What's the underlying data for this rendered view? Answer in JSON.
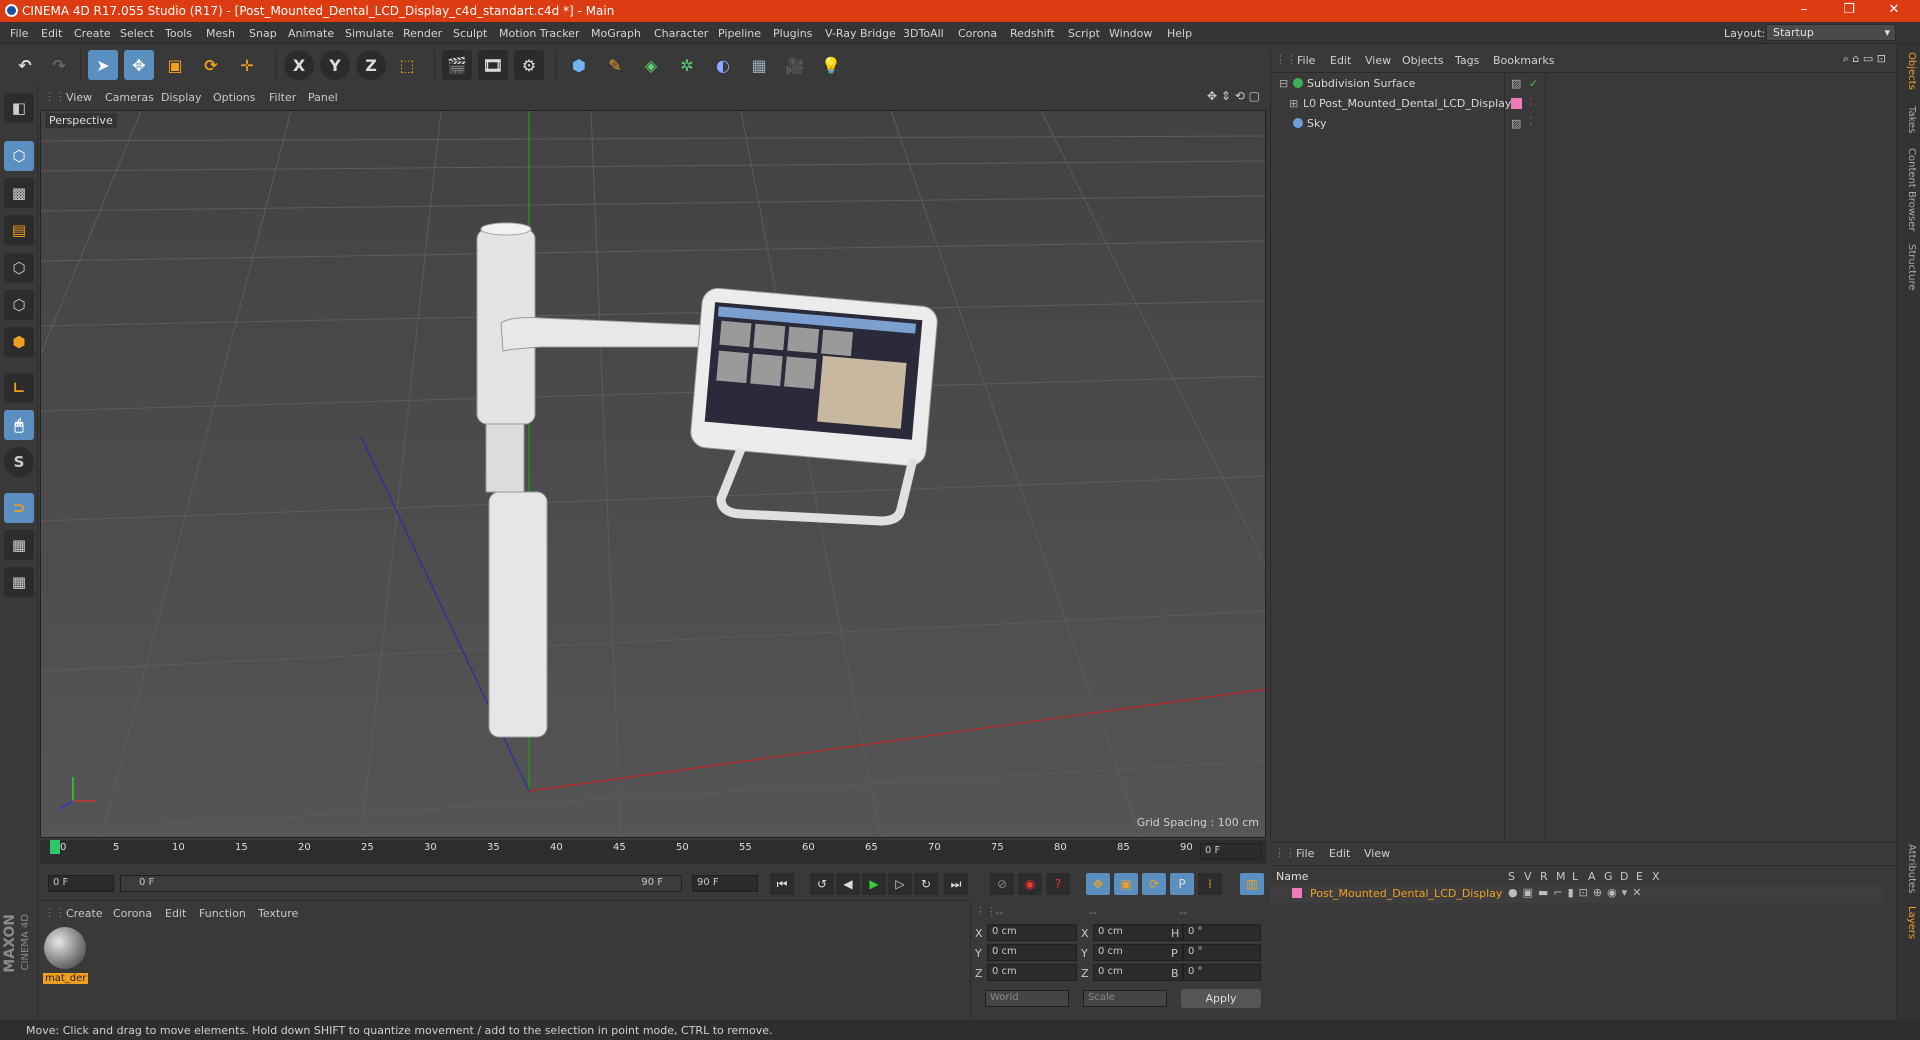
{
  "window": {
    "title": "CINEMA 4D R17.055 Studio (R17) - [Post_Mounted_Dental_LCD_Display_c4d_standart.c4d *] - Main",
    "controls": [
      "–",
      "❐",
      "✕"
    ]
  },
  "menu": [
    "File",
    "Edit",
    "Create",
    "Select",
    "Tools",
    "Mesh",
    "Snap",
    "Animate",
    "Simulate",
    "Render",
    "Sculpt",
    "Motion Tracker",
    "MoGraph",
    "Character",
    "Pipeline",
    "Plugins",
    "V-Ray Bridge",
    "3DToAll",
    "Corona",
    "Redshift",
    "Script",
    "Window",
    "Help"
  ],
  "layout": {
    "label": "Layout:",
    "value": "Startup"
  },
  "toolbar": {
    "axis_x": "X",
    "axis_y": "Y",
    "axis_z": "Z"
  },
  "viewport": {
    "menu": [
      "View",
      "Cameras",
      "Display",
      "Options",
      "Filter",
      "Panel"
    ],
    "camera_label": "Perspective",
    "grid_spacing": "Grid Spacing : 100 cm"
  },
  "timeline": {
    "ticks": [
      "0",
      "5",
      "10",
      "15",
      "20",
      "25",
      "30",
      "35",
      "40",
      "45",
      "50",
      "55",
      "60",
      "65",
      "70",
      "75",
      "80",
      "85",
      "90"
    ],
    "current_frame": "0 F",
    "start_field": "0 F",
    "range_start": "0 F",
    "range_end": "90 F",
    "end_field": "90 F"
  },
  "material_panel": {
    "menu": [
      "Create",
      "Corona",
      "Edit",
      "Function",
      "Texture"
    ],
    "material_name": "mat_der",
    "brand_top": "MAXON",
    "brand_bottom": "CINEMA 4D"
  },
  "coord_panel": {
    "headers": [
      "--",
      "--",
      "--"
    ],
    "rows": [
      {
        "a": "X",
        "av": "0 cm",
        "b": "X",
        "bv": "0 cm",
        "c": "H",
        "cv": "0 °"
      },
      {
        "a": "Y",
        "av": "0 cm",
        "b": "Y",
        "bv": "0 cm",
        "c": "P",
        "cv": "0 °"
      },
      {
        "a": "Z",
        "av": "0 cm",
        "b": "Z",
        "bv": "0 cm",
        "c": "B",
        "cv": "0 °"
      }
    ],
    "coord_mode": "World",
    "size_mode": "Scale",
    "apply_label": "Apply"
  },
  "object_manager": {
    "menu": [
      "File",
      "Edit",
      "View",
      "Objects",
      "Tags",
      "Bookmarks"
    ],
    "objects": [
      {
        "name": "Subdivision Surface",
        "color": "#3fae5a"
      },
      {
        "name": "Post_Mounted_Dental_LCD_Display",
        "color": "#9aa"
      },
      {
        "name": "Sky",
        "color": "#6ea0d8"
      }
    ]
  },
  "attribute_manager": {
    "menu": [
      "File",
      "Edit",
      "View"
    ],
    "columns": [
      "Name",
      "S",
      "V",
      "R",
      "M",
      "L",
      "A",
      "G",
      "D",
      "E",
      "X"
    ],
    "row_name": "Post_Mounted_Dental_LCD_Display"
  },
  "right_tabs": [
    "Objects",
    "Takes",
    "Content Browser",
    "Structure",
    "Attributes",
    "Layers"
  ],
  "status": "Move: Click and drag to move elements. Hold down SHIFT to quantize movement / add to the selection in point mode, CTRL to remove."
}
